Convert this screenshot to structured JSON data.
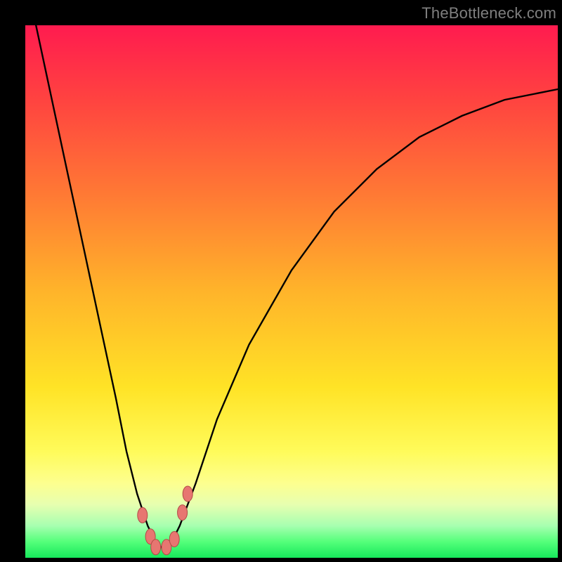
{
  "watermark": "TheBottleneck.com",
  "colors": {
    "frame": "#000000",
    "gradient_top": "#ff1b4f",
    "gradient_mid": "#ffe326",
    "gradient_bottom": "#16e85b",
    "curve": "#000000",
    "marker_fill": "#e77671",
    "marker_stroke": "#b24a46"
  },
  "chart_data": {
    "type": "line",
    "title": "",
    "xlabel": "",
    "ylabel": "",
    "xlim": [
      0,
      100
    ],
    "ylim": [
      0,
      100
    ],
    "grid": false,
    "legend": false,
    "series": [
      {
        "name": "curve",
        "x": [
          2,
          5,
          8,
          11,
          14,
          17,
          19,
          21,
          23,
          24.5,
          26,
          27.5,
          29,
          32,
          36,
          42,
          50,
          58,
          66,
          74,
          82,
          90,
          100
        ],
        "y": [
          100,
          86,
          72,
          58,
          44,
          30,
          20,
          12,
          6,
          3,
          1.5,
          3,
          6,
          14,
          26,
          40,
          54,
          65,
          73,
          79,
          83,
          86,
          88
        ]
      }
    ],
    "markers": [
      {
        "x": 22.0,
        "y": 8.0
      },
      {
        "x": 23.5,
        "y": 4.0
      },
      {
        "x": 24.5,
        "y": 2.0
      },
      {
        "x": 26.5,
        "y": 2.0
      },
      {
        "x": 28.0,
        "y": 3.5
      },
      {
        "x": 29.5,
        "y": 8.5
      },
      {
        "x": 30.5,
        "y": 12.0
      }
    ]
  }
}
